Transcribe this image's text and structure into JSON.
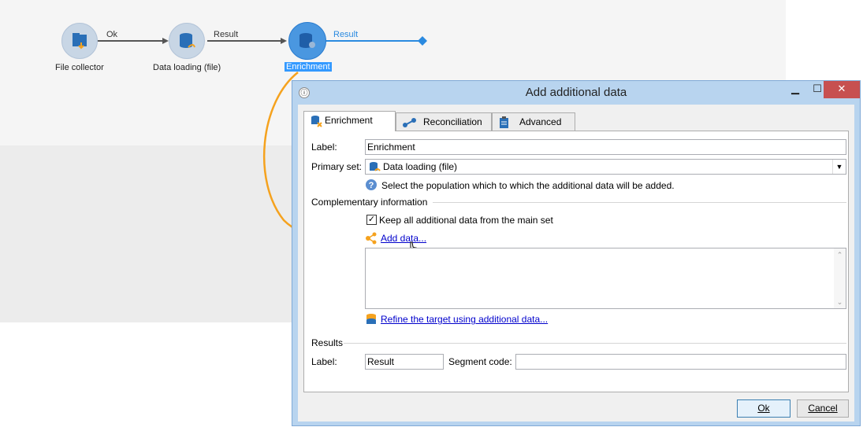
{
  "workflow": {
    "nodes": [
      {
        "label": "File collector"
      },
      {
        "label": "Data loading (file)"
      },
      {
        "label": "Enrichment"
      }
    ],
    "edges": [
      "Ok",
      "Result",
      "Result"
    ]
  },
  "dialog": {
    "title": "Add additional data",
    "controls": {
      "minimize": "▁",
      "maximize": "☐",
      "close": "✕"
    },
    "tabs": [
      "Enrichment",
      "Reconciliation",
      "Advanced"
    ],
    "label_field": {
      "label": "Label:",
      "value": "Enrichment"
    },
    "primary_set": {
      "label": "Primary set:",
      "value": "Data loading (file)"
    },
    "help_text": "Select the population which to which the additional data will be added.",
    "complementary": {
      "section_title": "Complementary information",
      "keep_all_label": "Keep all additional data from the main set",
      "keep_all_checked": true,
      "add_data_link": "Add data...",
      "refine_link": "Refine the target using additional data..."
    },
    "results": {
      "section_title": "Results",
      "label_label": "Label:",
      "label_value": "Result",
      "segment_label": "Segment code:",
      "segment_value": ""
    },
    "buttons": {
      "ok": "Ok",
      "cancel": "Cancel"
    }
  },
  "colors": {
    "accent_arrow": "#f5a21e",
    "selection": "#3399ff",
    "link": "#0000cc"
  }
}
